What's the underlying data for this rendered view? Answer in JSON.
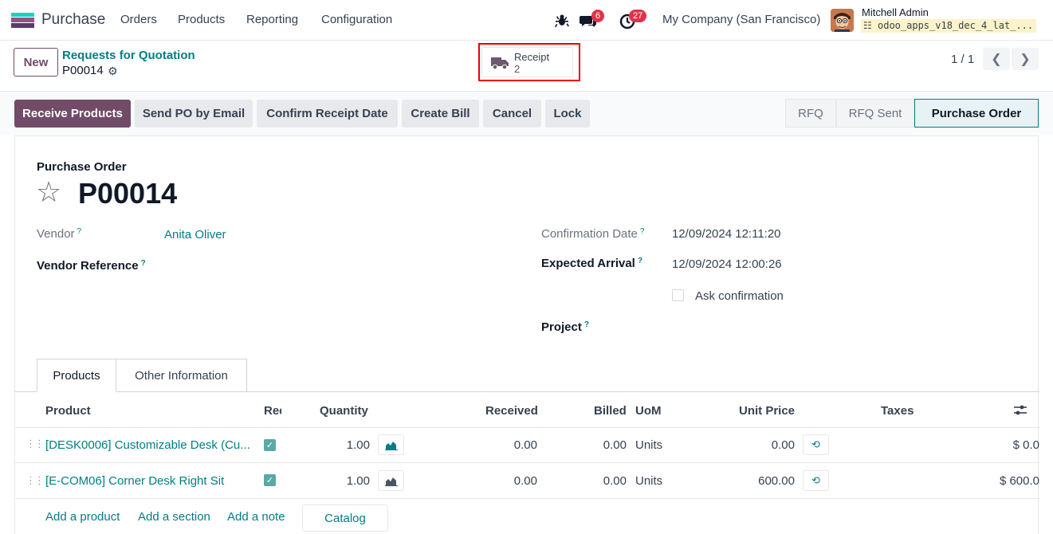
{
  "nav": {
    "app_name": "Purchase",
    "menus": [
      "Orders",
      "Products",
      "Reporting",
      "Configuration"
    ],
    "messages_count": "6",
    "activities_count": "27",
    "company": "My Company (San Francisco)",
    "user": "Mitchell Admin",
    "database": "odoo_apps_v18_dec_4_lat_..."
  },
  "control": {
    "new_label": "New",
    "breadcrumb": "Requests for Quotation",
    "record": "P00014",
    "receipt_label": "Receipt",
    "receipt_count": "2",
    "pager": "1 / 1"
  },
  "actions": {
    "receive": "Receive Products",
    "send_email": "Send PO by Email",
    "confirm_receipt": "Confirm Receipt Date",
    "create_bill": "Create Bill",
    "cancel": "Cancel",
    "lock": "Lock"
  },
  "status": {
    "stages": [
      "RFQ",
      "RFQ Sent",
      "Purchase Order"
    ],
    "active": "Purchase Order"
  },
  "form": {
    "doc_type": "Purchase Order",
    "number": "P00014",
    "vendor_label": "Vendor",
    "vendor": "Anita Oliver",
    "vendor_ref_label": "Vendor Reference",
    "confirmation_label": "Confirmation Date",
    "confirmation_date": "12/09/2024 12:11:20",
    "expected_label": "Expected Arrival",
    "expected_arrival": "12/09/2024 12:00:26",
    "ask_confirmation": "Ask confirmation",
    "project_label": "Project",
    "help_mark": "?"
  },
  "tabs": [
    "Products",
    "Other Information"
  ],
  "table": {
    "headers": {
      "product": "Product",
      "received_check": "Rec",
      "quantity": "Quantity",
      "received": "Received",
      "billed": "Billed",
      "uom": "UoM",
      "unit_price": "Unit Price",
      "taxes": "Taxes"
    },
    "rows": [
      {
        "product": "[DESK0006] Customizable Desk (Cu...",
        "quantity": "1.00",
        "received": "0.00",
        "billed": "0.00",
        "uom": "Units",
        "unit_price": "0.00",
        "subtotal": "$ 0.0"
      },
      {
        "product": "[E-COM06] Corner Desk Right Sit",
        "quantity": "1.00",
        "received": "0.00",
        "billed": "0.00",
        "uom": "Units",
        "unit_price": "600.00",
        "subtotal": "$ 600.0"
      }
    ],
    "add_product": "Add a product",
    "add_section": "Add a section",
    "add_note": "Add a note",
    "catalog": "Catalog"
  },
  "colors": {
    "brand": "#714b67",
    "link": "#017e84",
    "badge": "#e0334b",
    "highlight": "#ee0000"
  }
}
